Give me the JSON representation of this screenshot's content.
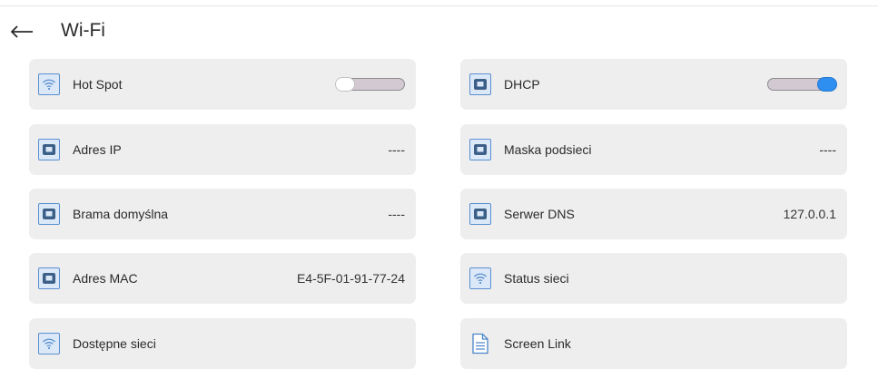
{
  "header": {
    "back_icon": "arrow-left-icon",
    "title": "Wi-Fi"
  },
  "colors": {
    "tile_bg": "#eeeeee",
    "icon_accent": "#5a8fd0",
    "toggle_on": "#2f8ff0"
  },
  "tiles": {
    "hot_spot": {
      "label": "Hot Spot",
      "icon": "wifi-icon",
      "toggle_state": "off"
    },
    "dhcp": {
      "label": "DHCP",
      "icon": "network-port-icon",
      "toggle_state": "on"
    },
    "adres_ip": {
      "label": "Adres IP",
      "icon": "network-port-icon",
      "value": "----"
    },
    "maska_podsieci": {
      "label": "Maska podsieci",
      "icon": "network-port-icon",
      "value": "----"
    },
    "brama_domyslna": {
      "label": "Brama domyślna",
      "icon": "network-port-icon",
      "value": "----"
    },
    "serwer_dns": {
      "label": "Serwer DNS",
      "icon": "network-port-icon",
      "value": "127.0.0.1"
    },
    "adres_mac": {
      "label": "Adres MAC",
      "icon": "network-port-icon",
      "value": "E4-5F-01-91-77-24"
    },
    "status_sieci": {
      "label": "Status sieci",
      "icon": "wifi-icon"
    },
    "dostepne_sieci": {
      "label": "Dostępne sieci",
      "icon": "wifi-icon"
    },
    "screen_link": {
      "label": "Screen Link",
      "icon": "document-icon"
    }
  }
}
